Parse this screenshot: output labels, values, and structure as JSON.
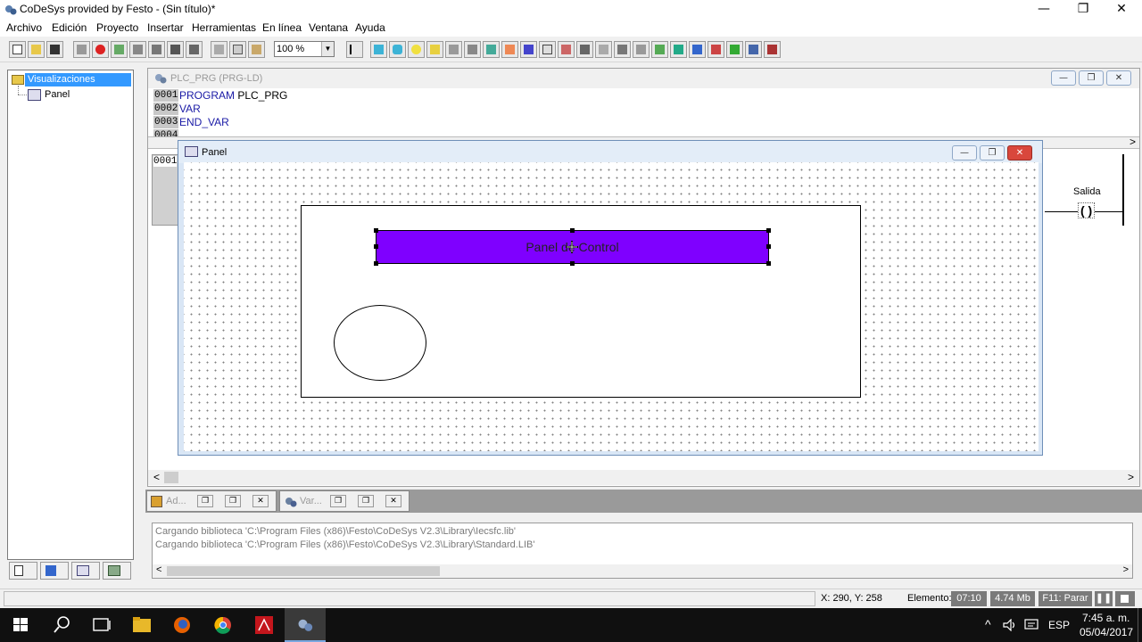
{
  "window": {
    "title": "CoDeSys provided by Festo - (Sin título)*",
    "minimize_glyph": "—",
    "maximize_glyph": "❐",
    "close_glyph": "✕"
  },
  "menu": [
    "Archivo",
    "Edición",
    "Proyecto",
    "Insertar",
    "Herramientas",
    "En línea",
    "Ventana",
    "Ayuda"
  ],
  "toolbar": {
    "zoom_value": "100 %",
    "zoom_arrow": "▼"
  },
  "tree": {
    "root": "Visualizaciones",
    "child": "Panel"
  },
  "plc_window": {
    "title": "PLC_PRG (PRG-LD)",
    "lines": [
      {
        "num": "0001",
        "kw": "PROGRAM",
        "rest": " PLC_PRG"
      },
      {
        "num": "0002",
        "kw": "VAR",
        "rest": ""
      },
      {
        "num": "0003",
        "kw": "END_VAR",
        "rest": ""
      },
      {
        "num": "0004",
        "kw": "",
        "rest": ""
      }
    ],
    "network_num": "0001",
    "coil_label": "Salida",
    "coil_symbol": "( )",
    "scroll_left": "<",
    "scroll_right": ">"
  },
  "panel_window": {
    "title": "Panel",
    "button_text": "Panel de Control",
    "button_color": "#7f00ff"
  },
  "doc_tabs": [
    {
      "label": "Ad..."
    },
    {
      "label": "Var..."
    }
  ],
  "messages": [
    "Cargando biblioteca 'C:\\Program Files (x86)\\Festo\\CoDeSys V2.3\\Library\\Iecsfc.lib'",
    "Cargando biblioteca 'C:\\Program Files (x86)\\Festo\\CoDeSys V2.3\\Library\\Standard.LIB'"
  ],
  "status": {
    "coords": "X:  290, Y:   258",
    "element": "Elemento:",
    "time": "07:10",
    "memory": "4.74 Mb",
    "f11": "F11: Parar"
  },
  "taskbar": {
    "lang": "ESP",
    "time": "7:45 a. m.",
    "date": "05/04/2017"
  }
}
